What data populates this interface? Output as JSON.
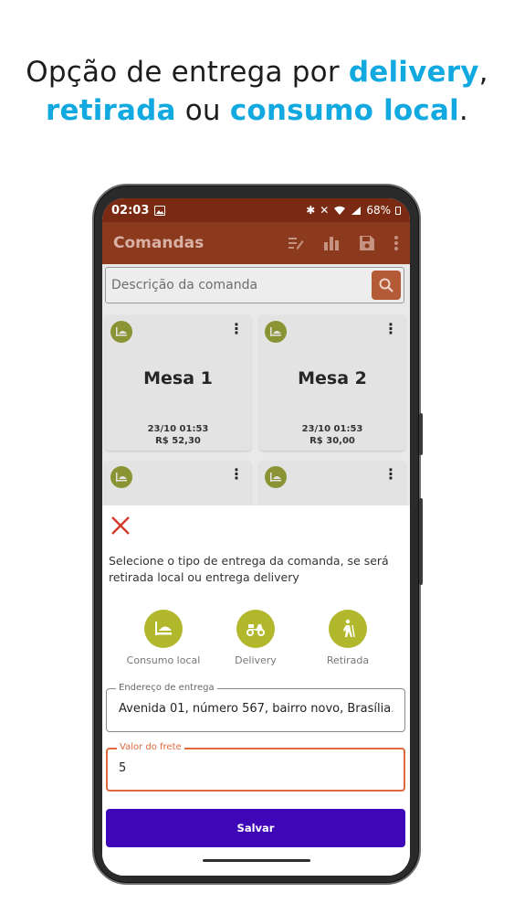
{
  "headline": {
    "part1": "Opção de entrega por ",
    "part2": "delivery",
    "part3": ",",
    "part4": "retirada",
    "part5": " ou ",
    "part6": "consumo local",
    "part7": "."
  },
  "status_bar": {
    "time": "02:03",
    "battery": "68%"
  },
  "app_bar": {
    "title": "Comandas"
  },
  "search": {
    "placeholder": "Descrição da comanda"
  },
  "cards": [
    {
      "name": "Mesa 1",
      "datetime": "23/10 01:53",
      "total": "R$ 52,30"
    },
    {
      "name": "Mesa 2",
      "datetime": "23/10 01:53",
      "total": "R$ 30,00"
    }
  ],
  "sheet": {
    "description": "Selecione o tipo de entrega da comanda, se será retirada local ou entrega delivery",
    "options": [
      {
        "label": "Consumo local",
        "icon": "table-icon"
      },
      {
        "label": "Delivery",
        "icon": "scooter-icon"
      },
      {
        "label": "Retirada",
        "icon": "walking-person-icon"
      }
    ],
    "address_field": {
      "label": "Endereço de entrega",
      "value": "Avenida 01, número 567, bairro novo, Brasília."
    },
    "freight_field": {
      "label": "Valor do frete",
      "value": "5"
    },
    "save_label": "Salvar"
  },
  "colors": {
    "accent_blue": "#12a9e1",
    "app_bar": "#8c3a1e",
    "option_green": "#b2b82c",
    "save_button": "#3f06b8",
    "focus_orange": "#e06a3e",
    "close_red": "#d23a2a"
  }
}
